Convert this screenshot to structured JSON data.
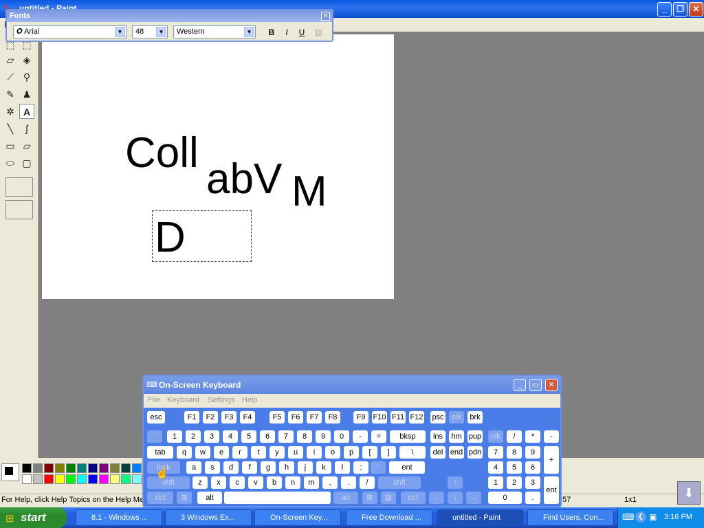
{
  "paint": {
    "title": "untitled - Paint",
    "menu_file": "F",
    "status_help": "For Help, click Help Topics on the Help Men",
    "status_coord": "57",
    "status_size": "1x1",
    "canvas_texts": [
      "Coll",
      "abV",
      "M",
      "D"
    ]
  },
  "fonts_toolbar": {
    "title": "Fonts",
    "font_name": "Arial",
    "font_size": "48",
    "script": "Western",
    "bold": "B",
    "italic": "I",
    "underline": "U"
  },
  "osk": {
    "title": "On-Screen Keyboard",
    "menu": [
      "File",
      "Keyboard",
      "Settings",
      "Help"
    ],
    "rows": [
      [
        "esc",
        "F1",
        "F2",
        "F3",
        "F4",
        "F5",
        "F6",
        "F7",
        "F8",
        "F9",
        "F10",
        "F11",
        "F12",
        "psc",
        "slk",
        "brk"
      ],
      [
        "`",
        "1",
        "2",
        "3",
        "4",
        "5",
        "6",
        "7",
        "8",
        "9",
        "0",
        "-",
        "=",
        "bksp",
        "ins",
        "hm",
        "pup",
        "nlk",
        "/",
        "*",
        "-"
      ],
      [
        "tab",
        "q",
        "w",
        "e",
        "r",
        "t",
        "y",
        "u",
        "i",
        "o",
        "p",
        "[",
        "]",
        "\\",
        "del",
        "end",
        "pdn",
        "7",
        "8",
        "9",
        "+"
      ],
      [
        "lock",
        "a",
        "s",
        "d",
        "f",
        "g",
        "h",
        "j",
        "k",
        "l",
        ";",
        "'",
        "ent",
        "4",
        "5",
        "6"
      ],
      [
        "shft",
        "z",
        "x",
        "c",
        "v",
        "b",
        "n",
        "m",
        ",",
        ".",
        "/",
        "shft",
        "↑",
        "1",
        "2",
        "3",
        "ent"
      ],
      [
        "ctrl",
        "alt",
        "alt",
        "ctrl",
        "←",
        "↓",
        "→",
        "0",
        "."
      ]
    ]
  },
  "taskbar": {
    "start": "start",
    "tasks": [
      "8.1 - Windows ...",
      "3 Windows Ex...",
      "On-Screen Key...",
      "Free Download ...",
      "untitled - Paint",
      "Find Users, Con..."
    ],
    "clock": "3:16 PM"
  },
  "colors": {
    "xp_blue": "#245edb",
    "start_green": "#2e8b2e",
    "workspace": "#808080"
  }
}
